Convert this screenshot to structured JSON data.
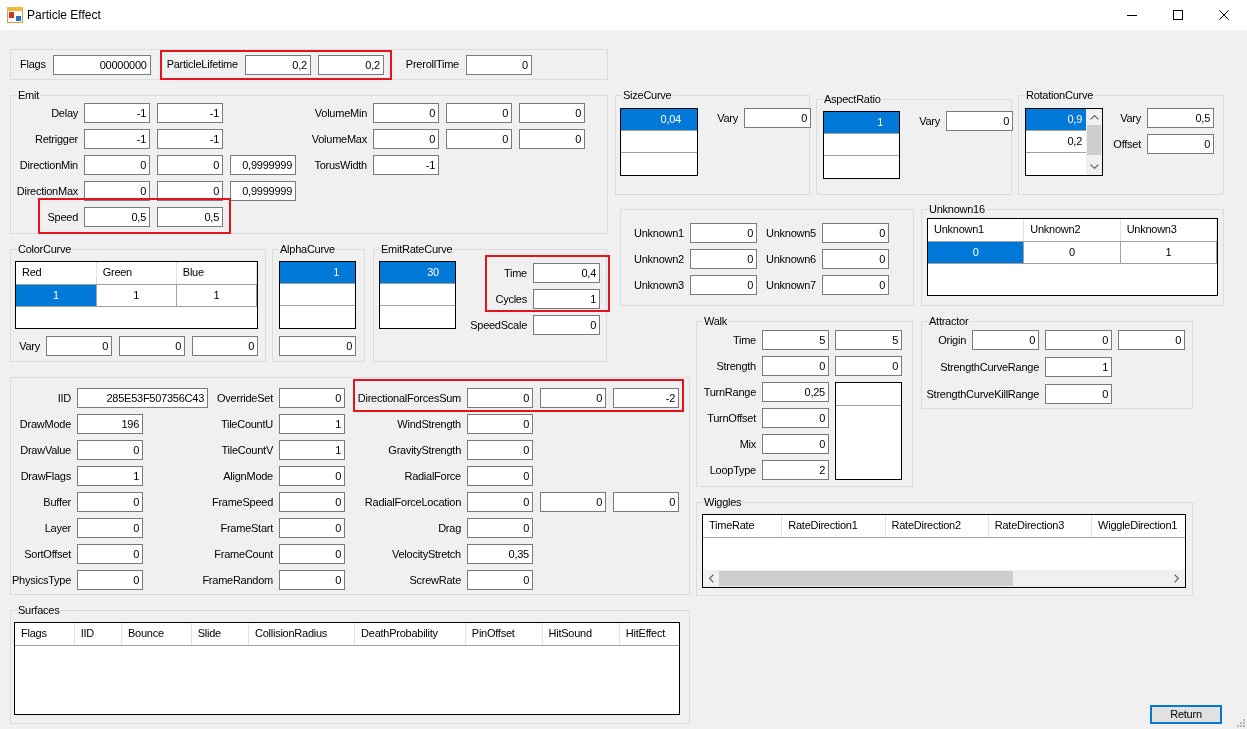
{
  "window": {
    "title": "Particle Effect"
  },
  "header": {
    "fields": [
      {
        "label": "Flags",
        "values": [
          "00000000"
        ],
        "highlighted": false
      },
      {
        "label": "ParticleLifetime",
        "values": [
          "0,2",
          "0,2"
        ],
        "highlighted": true
      },
      {
        "label": "PrerollTime",
        "values": [
          "0"
        ],
        "highlighted": false
      }
    ]
  },
  "emit": {
    "title": "Emit",
    "left_fields": [
      {
        "label": "Delay",
        "values": [
          "-1",
          "-1"
        ],
        "highlighted": false
      },
      {
        "label": "Retrigger",
        "values": [
          "-1",
          "-1"
        ],
        "highlighted": false
      },
      {
        "label": "DirectionMin",
        "values": [
          "0",
          "0",
          "0,9999999"
        ],
        "highlighted": false
      },
      {
        "label": "DirectionMax",
        "values": [
          "0",
          "0",
          "0,9999999"
        ],
        "highlighted": false
      },
      {
        "label": "Speed",
        "values": [
          "0,5",
          "0,5"
        ],
        "highlighted": true
      }
    ],
    "right_fields": [
      {
        "label": "VolumeMin",
        "values": [
          "0",
          "0",
          "0"
        ]
      },
      {
        "label": "VolumeMax",
        "values": [
          "0",
          "0",
          "0"
        ]
      },
      {
        "label": "TorusWidth",
        "values": [
          "-1"
        ]
      }
    ]
  },
  "size_curve": {
    "title": "SizeCurve",
    "items": [
      {
        "text": "0,04",
        "selected": true
      }
    ],
    "fields": [
      {
        "label": "Vary",
        "values": [
          "0"
        ]
      }
    ]
  },
  "aspect_ratio": {
    "title": "AspectRatio",
    "items": [
      {
        "text": "1",
        "selected": true
      }
    ],
    "fields": [
      {
        "label": "Vary",
        "values": [
          "0"
        ]
      }
    ]
  },
  "rotation_curve": {
    "title": "RotationCurve",
    "items": [
      {
        "text": "0,9",
        "selected": true
      },
      {
        "text": "0,2",
        "selected": false
      }
    ],
    "fields": [
      {
        "label": "Vary",
        "values": [
          "0,5"
        ]
      },
      {
        "label": "Offset",
        "values": [
          "0"
        ]
      }
    ]
  },
  "unknowns": {
    "left_fields": [
      {
        "label": "Unknown1",
        "values": [
          "0"
        ]
      },
      {
        "label": "Unknown2",
        "values": [
          "0"
        ]
      },
      {
        "label": "Unknown3",
        "values": [
          "0"
        ]
      }
    ],
    "right_fields": [
      {
        "label": "Unknown5",
        "values": [
          "0"
        ]
      },
      {
        "label": "Unknown6",
        "values": [
          "0"
        ]
      },
      {
        "label": "Unknown7",
        "values": [
          "0"
        ]
      }
    ]
  },
  "unknown16": {
    "title": "Unknown16",
    "columns": [
      "Unknown1",
      "Unknown2",
      "Unknown3"
    ],
    "rows": [
      [
        {
          "text": "0",
          "selected": true
        },
        {
          "text": "0",
          "selected": false
        },
        {
          "text": "1",
          "selected": false
        }
      ]
    ]
  },
  "color_curve": {
    "title": "ColorCurve",
    "columns": [
      "Red",
      "Green",
      "Blue"
    ],
    "rows": [
      [
        {
          "text": "1",
          "selected": true
        },
        {
          "text": "1",
          "selected": false
        },
        {
          "text": "1",
          "selected": false
        }
      ]
    ],
    "vary": {
      "label": "Vary",
      "values": [
        "0",
        "0",
        "0"
      ]
    }
  },
  "alpha_curve": {
    "title": "AlphaCurve",
    "items": [
      {
        "text": "1",
        "selected": true
      }
    ],
    "value": "0"
  },
  "emit_rate_curve": {
    "title": "EmitRateCurve",
    "items": [
      {
        "text": "30",
        "selected": true
      }
    ],
    "fields": [
      {
        "label": "Time",
        "values": [
          "0,4"
        ],
        "highlighted": true
      },
      {
        "label": "Cycles",
        "values": [
          "1"
        ],
        "highlighted": true
      },
      {
        "label": "SpeedScale",
        "values": [
          "0"
        ],
        "highlighted": false
      }
    ]
  },
  "walk": {
    "title": "Walk",
    "fields": [
      {
        "label": "Time",
        "values": [
          "5",
          "5"
        ]
      },
      {
        "label": "Strength",
        "values": [
          "0",
          "0"
        ]
      },
      {
        "label": "TurnRange",
        "values": [
          "0,25"
        ]
      },
      {
        "label": "TurnOffset",
        "values": [
          "0"
        ]
      },
      {
        "label": "Mix",
        "values": [
          "0"
        ]
      },
      {
        "label": "LoopType",
        "values": [
          "2"
        ]
      }
    ]
  },
  "attractor": {
    "title": "Attractor",
    "fields": [
      {
        "label": "Origin",
        "values": [
          "0",
          "0",
          "0"
        ]
      },
      {
        "label": "StrengthCurveRange",
        "values": [
          "1"
        ]
      },
      {
        "label": "StrengthCurveKillRange",
        "values": [
          "0"
        ]
      }
    ]
  },
  "properties": {
    "columns": [
      {
        "fields": [
          {
            "label": "IID",
            "values": [
              "285E53F507356C43"
            ]
          },
          {
            "label": "DrawMode",
            "values": [
              "196"
            ]
          },
          {
            "label": "DrawValue",
            "values": [
              "0"
            ]
          },
          {
            "label": "DrawFlags",
            "values": [
              "1"
            ]
          },
          {
            "label": "Buffer",
            "values": [
              "0"
            ]
          },
          {
            "label": "Layer",
            "values": [
              "0"
            ]
          },
          {
            "label": "SortOffset",
            "values": [
              "0"
            ]
          },
          {
            "label": "PhysicsType",
            "values": [
              "0"
            ]
          }
        ]
      },
      {
        "fields": [
          {
            "label": "OverrideSet",
            "values": [
              "0"
            ]
          },
          {
            "label": "TileCountU",
            "values": [
              "1"
            ]
          },
          {
            "label": "TileCountV",
            "values": [
              "1"
            ]
          },
          {
            "label": "AlignMode",
            "values": [
              "0"
            ]
          },
          {
            "label": "FrameSpeed",
            "values": [
              "0"
            ]
          },
          {
            "label": "FrameStart",
            "values": [
              "0"
            ]
          },
          {
            "label": "FrameCount",
            "values": [
              "0"
            ]
          },
          {
            "label": "FrameRandom",
            "values": [
              "0"
            ]
          }
        ]
      },
      {
        "fields": [
          {
            "label": "DirectionalForcesSum",
            "values": [
              "0",
              "0",
              "-2"
            ],
            "highlighted": true
          },
          {
            "label": "WindStrength",
            "values": [
              "0"
            ],
            "highlighted": false
          },
          {
            "label": "GravityStrength",
            "values": [
              "0"
            ],
            "highlighted": false
          },
          {
            "label": "RadialForce",
            "values": [
              "0"
            ],
            "highlighted": false
          },
          {
            "label": "RadialForceLocation",
            "values": [
              "0",
              "0",
              "0"
            ],
            "highlighted": false
          },
          {
            "label": "Drag",
            "values": [
              "0"
            ],
            "highlighted": false
          },
          {
            "label": "VelocityStretch",
            "values": [
              "0,35"
            ],
            "highlighted": false
          },
          {
            "label": "ScrewRate",
            "values": [
              "0"
            ],
            "highlighted": false
          }
        ]
      }
    ]
  },
  "wiggles": {
    "title": "Wiggles",
    "columns": [
      "TimeRate",
      "RateDirection1",
      "RateDirection2",
      "RateDirection3",
      "WiggleDirection1"
    ]
  },
  "surfaces": {
    "title": "Surfaces",
    "columns": [
      "Flags",
      "IID",
      "Bounce",
      "Slide",
      "CollisionRadius",
      "DeathProbability",
      "PinOffset",
      "HitSound",
      "HitEffect"
    ]
  },
  "return_button": {
    "label": "Return",
    "focused": true
  }
}
